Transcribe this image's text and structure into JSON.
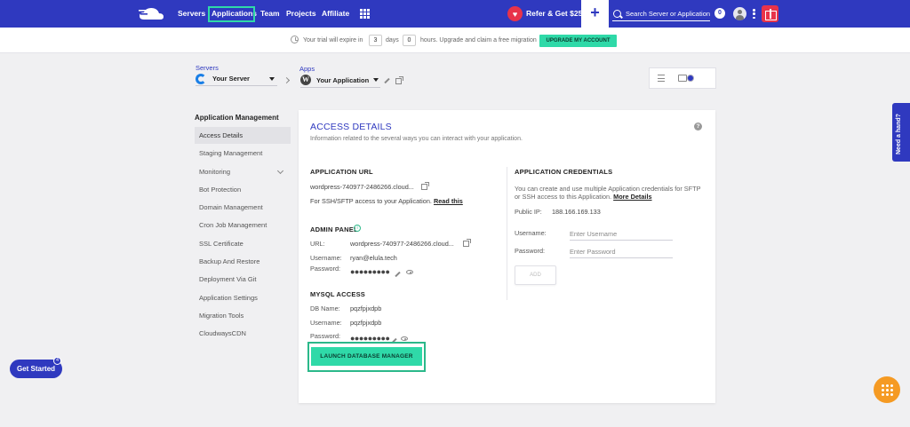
{
  "topnav": {
    "links": [
      "Servers",
      "Applications",
      "Team",
      "Projects",
      "Affiliate"
    ],
    "refer_label": "Refer & Get $25",
    "plus_label": "+",
    "search_placeholder": "Search Server or Application",
    "notif_count": "0"
  },
  "trial": {
    "prefix": "Your trial will expire in",
    "days_value": "3",
    "days_label": "days",
    "hours_value": "0",
    "suffix": "hours. Upgrade and claim a free migration",
    "upgrade_label": "UPGRADE MY ACCOUNT"
  },
  "breadcrumb": {
    "servers_label": "Servers",
    "server_name": "Your Server",
    "apps_label": "Apps",
    "app_name": "Your Application"
  },
  "sidebar": {
    "title": "Application Management",
    "items": [
      "Access Details",
      "Staging Management",
      "Monitoring",
      "Bot Protection",
      "Domain Management",
      "Cron Job Management",
      "SSL Certificate",
      "Backup And Restore",
      "Deployment Via Git",
      "Application Settings",
      "Migration Tools",
      "CloudwaysCDN"
    ],
    "active_index": 0
  },
  "access": {
    "title": "ACCESS DETAILS",
    "subtitle": "Information related to the several ways you can interact with your application.",
    "help": "?",
    "app_url": {
      "title": "APPLICATION URL",
      "url": "wordpress-740977-2486266.cloud...",
      "note": "For SSH/SFTP access to your Application.",
      "note_link": "Read this"
    },
    "admin_panel": {
      "title": "ADMIN PANEL",
      "url_label": "URL:",
      "url": "wordpress-740977-2486266.cloud...",
      "username_label": "Username:",
      "username": "ryan@elula.tech",
      "password_label": "Password:",
      "password_mask": "●●●●●●●●●"
    },
    "mysql": {
      "title": "MYSQL ACCESS",
      "db_label": "DB Name:",
      "db_name": "pqzfpjxdpb",
      "username_label": "Username:",
      "username": "pqzfpjxdpb",
      "password_label": "Password:",
      "password_mask": "●●●●●●●●●",
      "launch_label": "LAUNCH DATABASE MANAGER"
    },
    "credentials": {
      "title": "APPLICATION CREDENTIALS",
      "desc_line1": "You can create and use multiple Application credentials for SFTP",
      "desc_line2": "or SSH access to this Application.",
      "desc_link": "More Details",
      "public_ip_label": "Public IP:",
      "public_ip": "188.166.169.133",
      "username_label": "Username:",
      "username_placeholder": "Enter Username",
      "password_label": "Password:",
      "password_placeholder": "Enter Password",
      "add_label": "ADD"
    }
  },
  "floating": {
    "get_started": "Get Started",
    "get_started_badge": "4",
    "need_hand": "Need a hand?"
  },
  "colors": {
    "brand": "#2f39bf",
    "accent": "#2fd9a8",
    "cta": "#f59a23"
  }
}
